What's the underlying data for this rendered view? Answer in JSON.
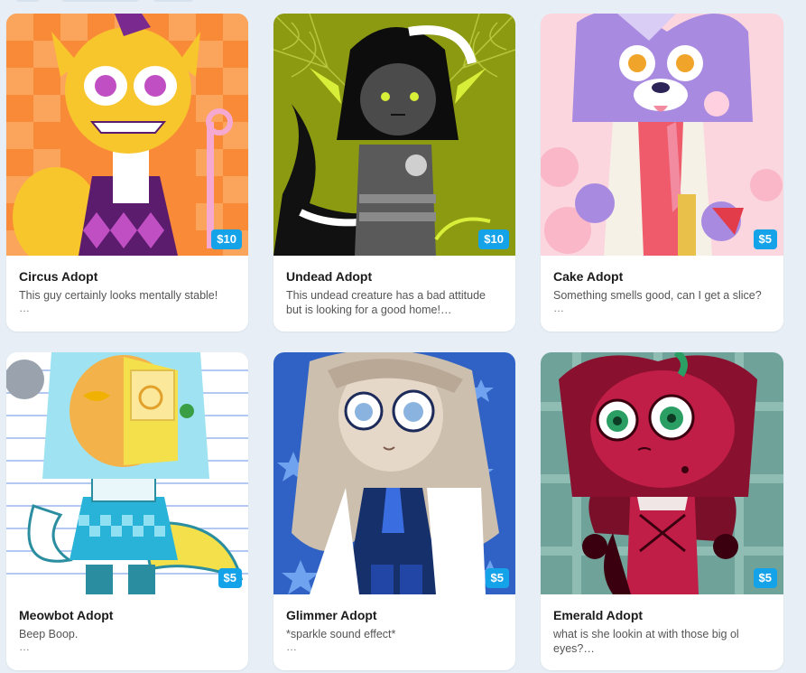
{
  "cards": [
    {
      "title": "Circus Adopt",
      "desc": "This guy certainly looks mentally stable!",
      "more": "…",
      "price": "$10",
      "bg": "#f98b38",
      "accent": "#f7c52c"
    },
    {
      "title": "Undead Adopt",
      "desc": "This undead creature has a bad attitude but is looking for a good home!…",
      "more": "",
      "price": "$10",
      "bg": "#8c9a12",
      "accent": "#1a1a1a"
    },
    {
      "title": "Cake Adopt",
      "desc": "Something smells good, can I get a slice?",
      "more": "…",
      "price": "$5",
      "bg": "#fbd6df",
      "accent": "#a88ae0"
    },
    {
      "title": "Meowbot Adopt",
      "desc": "Beep Boop.",
      "more": "…",
      "price": "$5",
      "bg": "#ffffff",
      "accent": "#9fe3f2"
    },
    {
      "title": "Glimmer Adopt",
      "desc": "*sparkle sound effect*",
      "more": "…",
      "price": "$5",
      "bg": "#2f62c4",
      "accent": "#cdbfae"
    },
    {
      "title": "Emerald Adopt",
      "desc": "what is she lookin at with those big ol eyes?…",
      "more": "",
      "price": "$5",
      "bg": "#6fa39a",
      "accent": "#b3173f"
    }
  ]
}
